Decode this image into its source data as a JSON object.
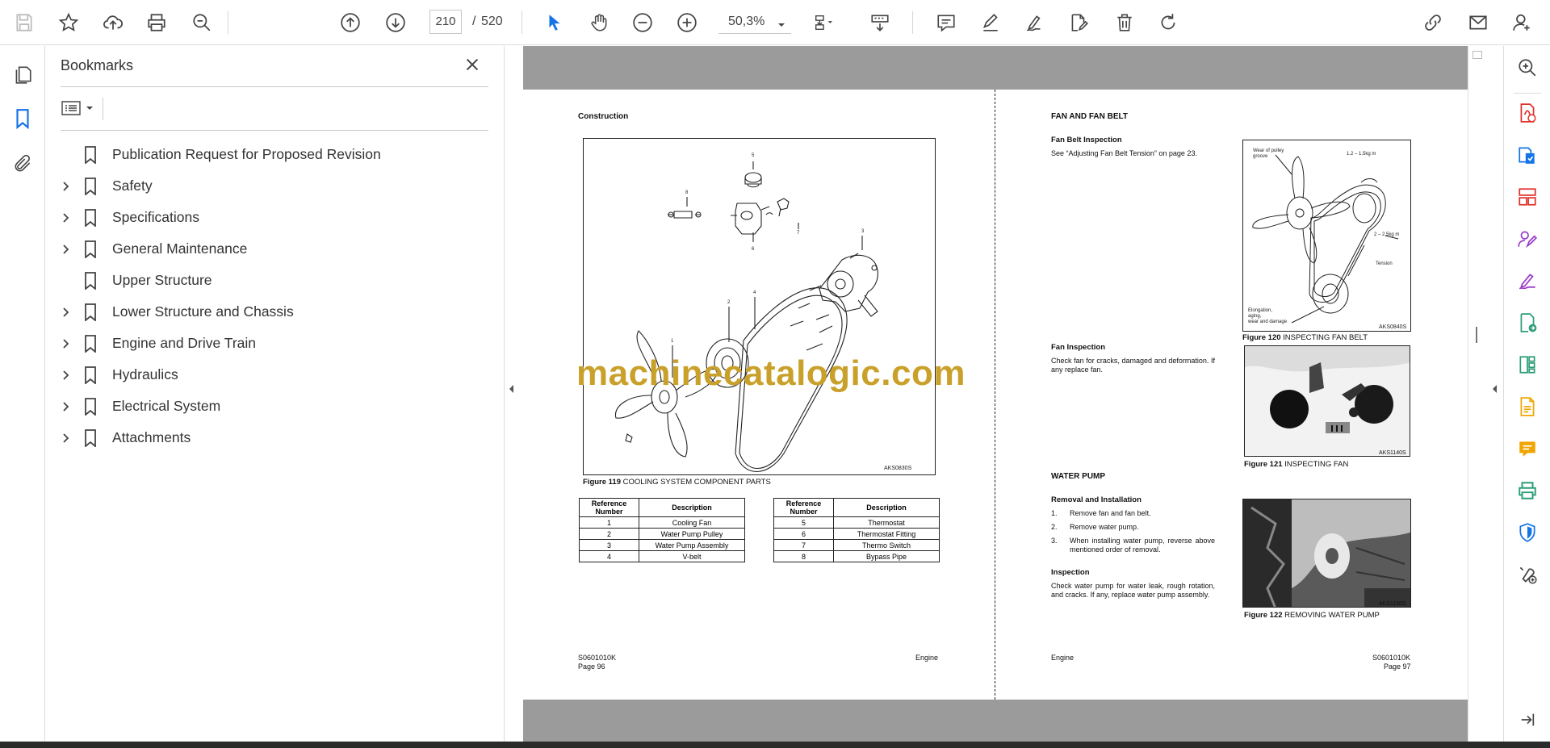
{
  "toolbar": {
    "page_current": "210",
    "page_separator": "/",
    "page_total": "520",
    "zoom": "50,3%",
    "icons": [
      "save-icon",
      "star-icon",
      "cloud-upload-icon",
      "print-icon",
      "zoom-search-icon",
      "page-up-icon",
      "page-down-icon",
      "select-cursor-icon",
      "hand-icon",
      "zoom-out-icon",
      "zoom-in-icon",
      "fit-page-icon",
      "keyboard-scroll-icon",
      "comment-icon",
      "highlight-pen-icon",
      "sign-icon",
      "edit-pdf-icon",
      "delete-icon",
      "rotate-icon",
      "share-link-icon",
      "email-icon",
      "account-icon"
    ],
    "accent_color": "#1473e6"
  },
  "left_rail": {
    "icons": [
      "pages-icon",
      "bookmark-icon",
      "attachment-icon"
    ],
    "active": "bookmark-icon"
  },
  "bookmarks": {
    "title": "Bookmarks",
    "items": [
      {
        "label": "Publication Request for Proposed Revision",
        "expandable": false
      },
      {
        "label": "Safety",
        "expandable": true
      },
      {
        "label": "Specifications",
        "expandable": true
      },
      {
        "label": "General Maintenance",
        "expandable": true
      },
      {
        "label": "Upper Structure",
        "expandable": false
      },
      {
        "label": "Lower Structure and Chassis",
        "expandable": true
      },
      {
        "label": "Engine and Drive Train",
        "expandable": true
      },
      {
        "label": "Hydraulics",
        "expandable": true
      },
      {
        "label": "Electrical System",
        "expandable": true
      },
      {
        "label": "Attachments",
        "expandable": true
      }
    ]
  },
  "document": {
    "left_page": {
      "heading": "Construction",
      "figure_code": "AKS0830S",
      "figure_caption_num": "Figure 119",
      "figure_caption": "COOLING SYSTEM COMPONENT PARTS",
      "diagram_labels": [
        "5",
        "6",
        "7",
        "8",
        "3",
        "2",
        "1",
        "4"
      ],
      "table1": {
        "headers": [
          "Reference Number",
          "Description"
        ],
        "rows": [
          [
            "1",
            "Cooling Fan"
          ],
          [
            "2",
            "Water Pump Pulley"
          ],
          [
            "3",
            "Water Pump Assembly"
          ],
          [
            "4",
            "V-belt"
          ]
        ]
      },
      "table2": {
        "headers": [
          "Reference Number",
          "Description"
        ],
        "rows": [
          [
            "5",
            "Thermostat"
          ],
          [
            "6",
            "Thermostat Fitting"
          ],
          [
            "7",
            "Thermo Switch"
          ],
          [
            "8",
            "Bypass Pipe"
          ]
        ]
      },
      "footer_code": "S0601010K",
      "footer_page": "Page 96",
      "footer_section": "Engine"
    },
    "right_page": {
      "heading": "FAN AND FAN BELT",
      "fan_belt_heading": "Fan Belt Inspection",
      "fan_belt_text": "See “Adjusting Fan Belt Tension” on page 23.",
      "fig120_labels": [
        "Wear of pulley groove",
        "1.2 – 1.5kg m",
        "2 – 2.5kg m",
        "Tension",
        "Elongation, aging, wear and damage"
      ],
      "fig120_code": "AKS0840S",
      "fig120_num": "Figure 120",
      "fig120_caption": "INSPECTING FAN BELT",
      "fan_heading": "Fan Inspection",
      "fan_text": "Check fan for cracks, damaged and deformation. If any replace fan.",
      "fig121_code": "AKS1140S",
      "fig121_num": "Figure 121",
      "fig121_caption": "INSPECTING FAN",
      "water_pump_heading": "WATER PUMP",
      "removal_heading": "Removal and Installation",
      "steps": [
        {
          "n": "1.",
          "text": "Remove fan and fan belt."
        },
        {
          "n": "2.",
          "text": "Remove water pump."
        },
        {
          "n": "3.",
          "text": "When installing water pump, reverse above mentioned order of removal."
        }
      ],
      "inspection_heading": "Inspection",
      "inspection_text": "Check water pump for water leak, rough rotation, and cracks. If any, replace water pump assembly.",
      "fig122_code": "AKS1150S",
      "fig122_num": "Figure 122",
      "fig122_caption": "REMOVING WATER PUMP",
      "footer_section": "Engine",
      "footer_code": "S0601010K",
      "footer_page": "Page 97"
    },
    "watermark": "machinecatalogic.com",
    "watermark_color": "#c9a12a"
  },
  "right_rail": {
    "icons": [
      "enhance-search-icon",
      "export-pdf-icon",
      "create-pdf-icon",
      "organize-pages-icon",
      "request-signature-icon",
      "fill-sign-icon",
      "export-image-icon",
      "compress-icon",
      "send-file-icon",
      "comment-bubble-icon",
      "print-production-icon",
      "protect-icon",
      "more-tools-icon",
      "collapse-panel-icon"
    ],
    "icon_colors": [
      "#444444",
      "#e0312b",
      "#1473e6",
      "#e0312b",
      "#9b3cc9",
      "#9b3cc9",
      "#2d9d78",
      "#2d9d78",
      "#f0a500",
      "#f0a500",
      "#2d9d78",
      "#1473e6",
      "#444444",
      "#444444"
    ]
  }
}
